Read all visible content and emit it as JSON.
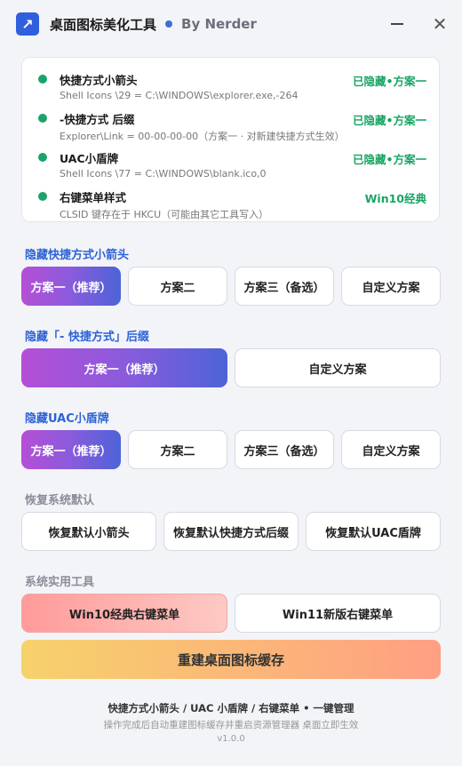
{
  "window": {
    "title": "桌面图标美化工具",
    "author": "By Nerder",
    "app_icon_glyph": "↗",
    "close_glyph": "✕",
    "icons": [
      "arrow-icon",
      "minimize-icon",
      "close-icon"
    ]
  },
  "status": [
    {
      "name": "快捷方式小箭头",
      "detail": "Shell Icons \\29 = C:\\WINDOWS\\explorer.exe,-264",
      "value": "已隐藏•方案一"
    },
    {
      "name": "-快捷方式 后缀",
      "detail": "Explorer\\Link = 00-00-00-00（方案一 · 对新建快捷方式生效）",
      "value": "已隐藏•方案一"
    },
    {
      "name": "UAC小盾牌",
      "detail": "Shell Icons \\77 = C:\\WINDOWS\\blank.ico,0",
      "value": "已隐藏•方案一"
    },
    {
      "name": "右键菜单样式",
      "detail": "CLSID 键存在于 HKCU（可能由其它工具写入）",
      "value": "Win10经典"
    }
  ],
  "sections": {
    "arrow": {
      "title": "隐藏快捷方式小箭头",
      "buttons": [
        "方案一（推荐）",
        "方案二",
        "方案三（备选）",
        "自定义方案"
      ]
    },
    "suffix": {
      "title": "隐藏「- 快捷方式」后缀",
      "buttons": [
        "方案一（推荐）",
        "自定义方案"
      ]
    },
    "uac": {
      "title": "隐藏UAC小盾牌",
      "buttons": [
        "方案一（推荐）",
        "方案二",
        "方案三（备选）",
        "自定义方案"
      ]
    },
    "restore": {
      "title": "恢复系统默认",
      "buttons": [
        "恢复默认小箭头",
        "恢复默认快捷方式后缀",
        "恢复默认UAC盾牌"
      ]
    },
    "tools": {
      "title": "系统实用工具",
      "buttons": [
        "Win10经典右键菜单",
        "Win11新版右键菜单"
      ],
      "rebuild": "重建桌面图标缓存"
    }
  },
  "footer": {
    "main": "快捷方式小箭头 / UAC 小盾牌 / 右键菜单 • 一键管理",
    "sub": "操作完成后自动重建图标缓存并重启资源管理器 桌面立即生效",
    "version": "v1.0.0"
  },
  "colors": {
    "accent": "#2c62d6",
    "status_ok": "#19a463",
    "primary_gradient_start": "#b54fd6",
    "primary_gradient_end": "#4d63d8"
  }
}
